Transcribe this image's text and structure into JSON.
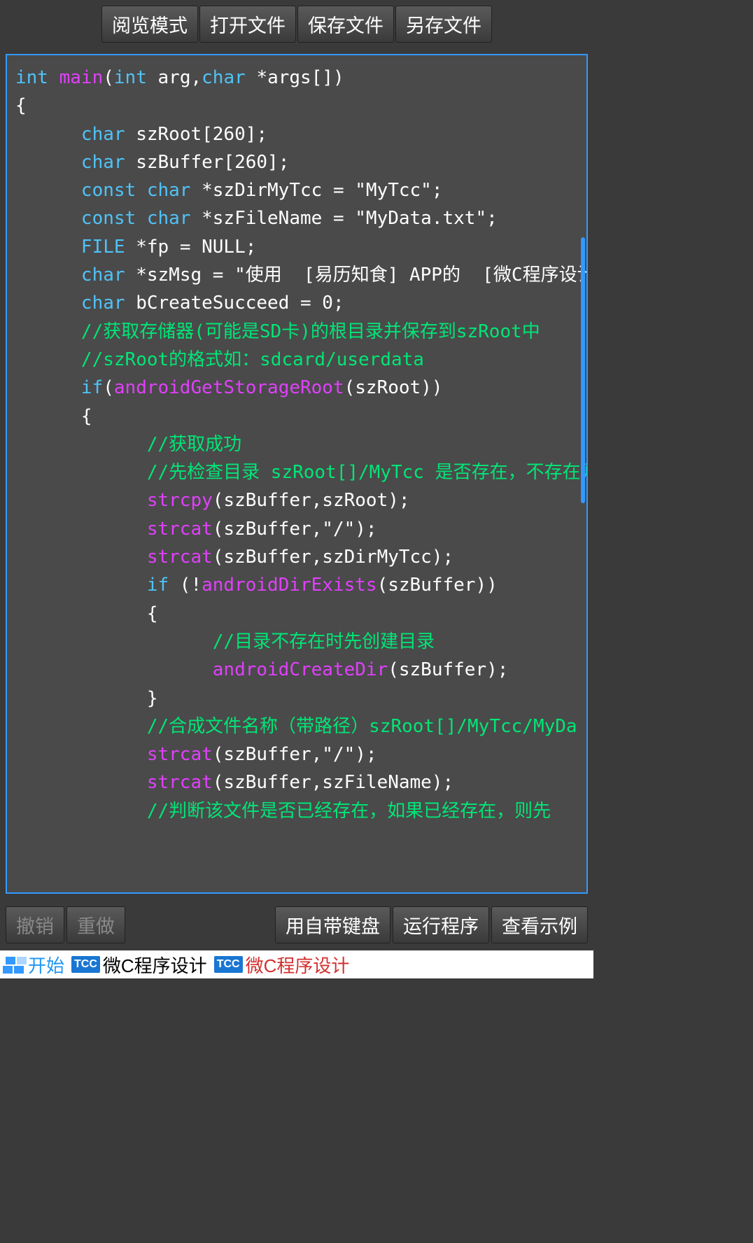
{
  "toolbar_top": {
    "read_mode": "阅览模式",
    "open_file": "打开文件",
    "save_file": "保存文件",
    "save_as": "另存文件"
  },
  "toolbar_bottom": {
    "undo": "撤销",
    "redo": "重做",
    "keyboard": "用自带键盘",
    "run": "运行程序",
    "examples": "查看示例"
  },
  "taskbar": {
    "start": "开始",
    "tcc_label": "TCC",
    "task1": "微C程序设计",
    "task2": "微C程序设计"
  },
  "code": {
    "tokens": [
      {
        "t": "kw",
        "v": "int "
      },
      {
        "t": "fn",
        "v": "main"
      },
      {
        "t": "",
        "v": "("
      },
      {
        "t": "kw",
        "v": "int "
      },
      {
        "t": "",
        "v": "arg,"
      },
      {
        "t": "kw",
        "v": "char "
      },
      {
        "t": "",
        "v": "*args[])\n{\n      "
      },
      {
        "t": "kw",
        "v": "char "
      },
      {
        "t": "",
        "v": "szRoot[260];\n      "
      },
      {
        "t": "kw",
        "v": "char "
      },
      {
        "t": "",
        "v": "szBuffer[260];\n      "
      },
      {
        "t": "kw",
        "v": "const char "
      },
      {
        "t": "",
        "v": "*szDirMyTcc = \"MyTcc\";\n      "
      },
      {
        "t": "kw",
        "v": "const char "
      },
      {
        "t": "",
        "v": "*szFileName = \"MyData.txt\";\n      "
      },
      {
        "t": "kw",
        "v": "FILE "
      },
      {
        "t": "",
        "v": "*fp = NULL;\n      "
      },
      {
        "t": "kw",
        "v": "char "
      },
      {
        "t": "",
        "v": "*szMsg = \"使用  [易历知食] APP的  [微C程序设计\n      "
      },
      {
        "t": "kw",
        "v": "char "
      },
      {
        "t": "",
        "v": "bCreateSucceed = 0;\n      "
      },
      {
        "t": "cm",
        "v": "//获取存储器(可能是SD卡)的根目录并保存到szRoot中"
      },
      {
        "t": "",
        "v": "\n      "
      },
      {
        "t": "cm",
        "v": "//szRoot的格式如：sdcard/userdata"
      },
      {
        "t": "",
        "v": "\n      "
      },
      {
        "t": "kw",
        "v": "if"
      },
      {
        "t": "",
        "v": "("
      },
      {
        "t": "fn",
        "v": "androidGetStorageRoot"
      },
      {
        "t": "",
        "v": "(szRoot))\n      {\n            "
      },
      {
        "t": "cm",
        "v": "//获取成功"
      },
      {
        "t": "",
        "v": "\n            "
      },
      {
        "t": "cm",
        "v": "//先检查目录 szRoot[]/MyTcc 是否存在，不存在则"
      },
      {
        "t": "",
        "v": "\n            "
      },
      {
        "t": "fn",
        "v": "strcpy"
      },
      {
        "t": "",
        "v": "(szBuffer,szRoot);\n            "
      },
      {
        "t": "fn",
        "v": "strcat"
      },
      {
        "t": "",
        "v": "(szBuffer,\"/\");\n            "
      },
      {
        "t": "fn",
        "v": "strcat"
      },
      {
        "t": "",
        "v": "(szBuffer,szDirMyTcc);\n            "
      },
      {
        "t": "kw",
        "v": "if"
      },
      {
        "t": "",
        "v": " (!"
      },
      {
        "t": "fn",
        "v": "androidDirExists"
      },
      {
        "t": "",
        "v": "(szBuffer))\n            {\n                  "
      },
      {
        "t": "cm",
        "v": "//目录不存在时先创建目录"
      },
      {
        "t": "",
        "v": "\n                  "
      },
      {
        "t": "fn",
        "v": "androidCreateDir"
      },
      {
        "t": "",
        "v": "(szBuffer);\n            }\n            "
      },
      {
        "t": "cm",
        "v": "//合成文件名称（带路径）szRoot[]/MyTcc/MyDa"
      },
      {
        "t": "",
        "v": "\n            "
      },
      {
        "t": "fn",
        "v": "strcat"
      },
      {
        "t": "",
        "v": "(szBuffer,\"/\");\n            "
      },
      {
        "t": "fn",
        "v": "strcat"
      },
      {
        "t": "",
        "v": "(szBuffer,szFileName);\n            "
      },
      {
        "t": "cm",
        "v": "//判断该文件是否已经存在，如果已经存在，则先"
      }
    ]
  }
}
